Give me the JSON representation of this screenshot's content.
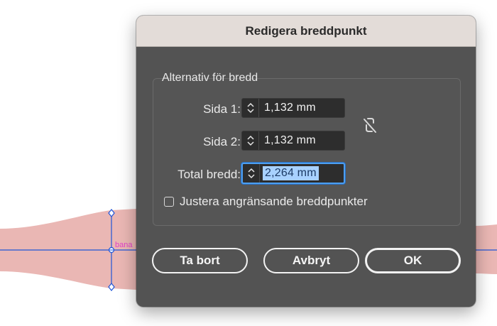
{
  "canvas": {
    "path_label": "bana",
    "path_fill_color": "#eab7b4",
    "guide_color": "#1f55d8"
  },
  "dialog": {
    "title": "Redigera breddpunkt",
    "group_label": "Alternativ för bredd",
    "side1": {
      "label": "Sida 1:",
      "value": "1,132 mm"
    },
    "side2": {
      "label": "Sida 2:",
      "value": "1,132 mm"
    },
    "total": {
      "label": "Total bredd:",
      "value": "2,264 mm"
    },
    "link_icon": "broken-link-icon",
    "checkbox": {
      "label": "Justera angränsande breddpunkter",
      "checked": false
    },
    "buttons": {
      "delete": "Ta bort",
      "cancel": "Avbryt",
      "ok": "OK"
    }
  }
}
